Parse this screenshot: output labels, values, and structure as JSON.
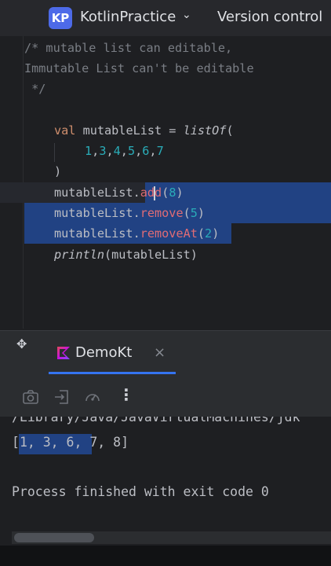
{
  "header": {
    "project_initials": "KP",
    "project_name": "KotlinPractice",
    "project_chevron": "⌄",
    "version_control": "Version control"
  },
  "editor": {
    "comment1": "/* mutable list can editable,",
    "comment2": "Immutable List can't be editable",
    "comment3": " */",
    "decl_kw": "val",
    "decl_name": " mutableList = ",
    "decl_fn": "listOf",
    "decl_open": "(",
    "list_values": [
      "1",
      "3",
      "4",
      "5",
      "6",
      "7"
    ],
    "close_paren": ")",
    "call_add_obj": "mutableList.",
    "call_add_fn": "add",
    "call_add_arg": "8",
    "call_remove_obj": "mutableList.",
    "call_remove_fn": "remove",
    "call_remove_arg": "5",
    "call_removeat_obj": "mutableList.",
    "call_removeat_fn": "removeAt",
    "call_removeat_arg": "2",
    "println_fn": "println",
    "println_arg": "(mutableList)"
  },
  "run_panel": {
    "move_icon": "move-icon",
    "tab_label": "DemoKt",
    "tab_close": "×",
    "more_label": "⋮"
  },
  "console": {
    "path_line": "/Library/Java/JavaVirtualMachines/jdk",
    "output_open": "[",
    "output_selected": "1, 3, 6,",
    "output_rest": " 7, 8]",
    "exit_line": "Process finished with exit code 0"
  },
  "colors": {
    "accent": "#3574f0",
    "selection": "#214283",
    "keyword": "#cf8e6d",
    "function": "#56a8f5",
    "number": "#2aacb8",
    "comment": "#7a7e85"
  }
}
